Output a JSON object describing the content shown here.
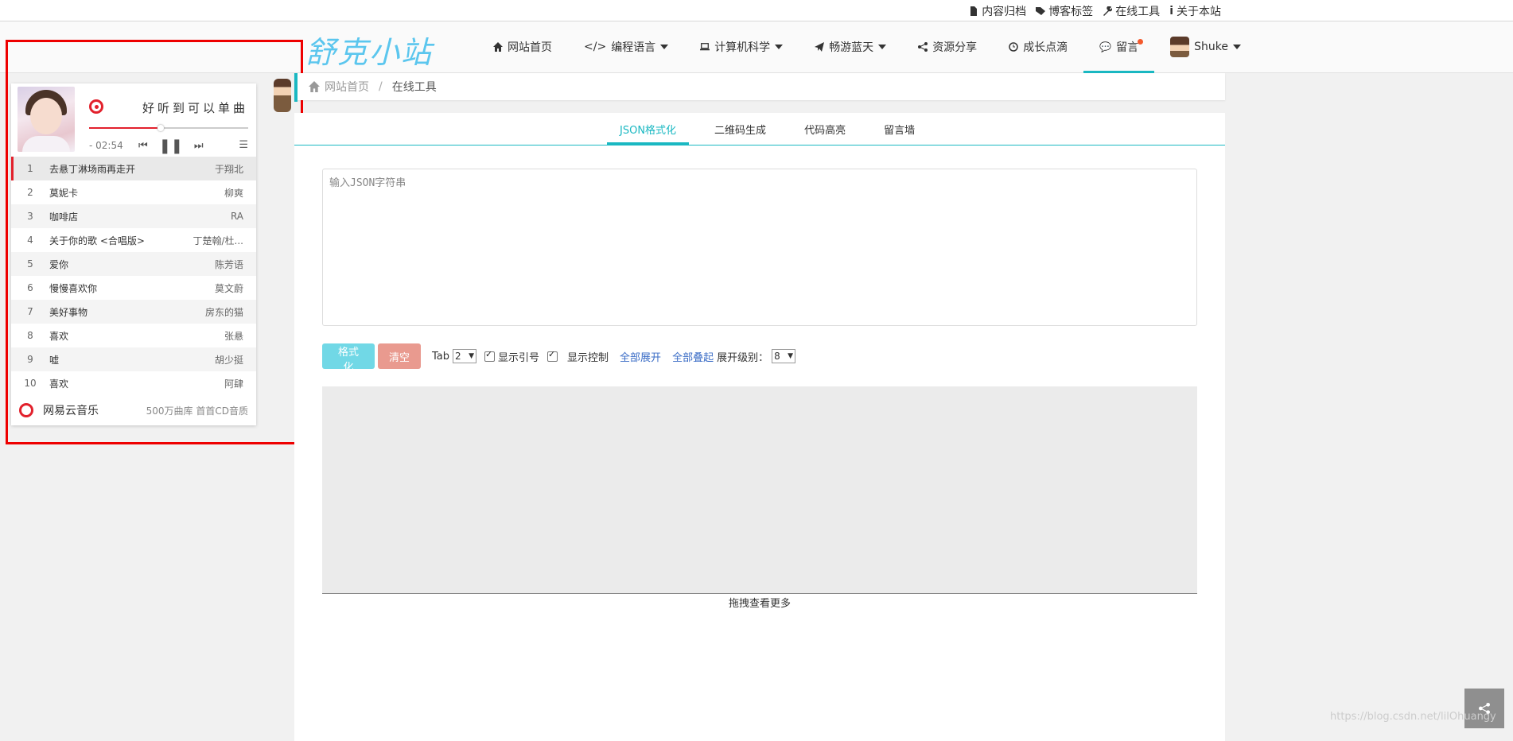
{
  "topbar": {
    "links": [
      {
        "label": "内容归档",
        "icon": "file-icon"
      },
      {
        "label": "博客标签",
        "icon": "tags-icon"
      },
      {
        "label": "在线工具",
        "icon": "wrench-icon"
      },
      {
        "label": "关于本站",
        "icon": "info-icon"
      }
    ]
  },
  "nav": {
    "logo": "舒克小站",
    "items": [
      {
        "label": "网站首页",
        "icon": "home-icon"
      },
      {
        "label": "编程语言",
        "icon": "code-icon"
      },
      {
        "label": "计算机科学",
        "icon": "laptop-icon"
      },
      {
        "label": "畅游蓝天",
        "icon": "paper-plane-icon"
      },
      {
        "label": "资源分享",
        "icon": "share-icon"
      },
      {
        "label": "成长点滴",
        "icon": "clock-icon"
      },
      {
        "label": "留言",
        "icon": "comment-icon"
      },
      {
        "label": "Shuke",
        "icon": "avatar"
      }
    ],
    "accent": "#1ab8c2"
  },
  "player": {
    "title": "好听到可以单曲",
    "time": "- 02:54",
    "progress": 0.45,
    "tracks": [
      {
        "n": "1",
        "title": "去悬丁淋场雨再走开",
        "artist": "于翔北"
      },
      {
        "n": "2",
        "title": "莫妮卡",
        "artist": "柳爽"
      },
      {
        "n": "3",
        "title": "咖啡店",
        "artist": "RA"
      },
      {
        "n": "4",
        "title": "关于你的歌 <合唱版>",
        "artist": "丁楚翰/杜..."
      },
      {
        "n": "5",
        "title": "爱你",
        "artist": "陈芳语"
      },
      {
        "n": "6",
        "title": "慢慢喜欢你",
        "artist": "莫文蔚"
      },
      {
        "n": "7",
        "title": "美好事物",
        "artist": "房东的猫"
      },
      {
        "n": "8",
        "title": "喜欢",
        "artist": "张悬"
      },
      {
        "n": "9",
        "title": "嘘",
        "artist": "胡少挺"
      },
      {
        "n": "10",
        "title": "喜欢",
        "artist": "阿肆"
      }
    ],
    "footer_brand": "网易云音乐",
    "footer_sub": "500万曲库 首首CD音质"
  },
  "breadcrumb": {
    "home": "网站首页",
    "separator": "/",
    "current": "在线工具"
  },
  "tabs": [
    "JSON格式化",
    "二维码生成",
    "代码高亮",
    "留言墙"
  ],
  "editor": {
    "placeholder": "输入JSON字符串",
    "value": ""
  },
  "toolbar": {
    "format_label": "格式化",
    "clear_label": "清空",
    "tab_label": "Tab",
    "tab_value": "2",
    "show_quotes_label": "显示引号",
    "show_controls_label": "显示控制",
    "expand_all_label": "全部展开",
    "collapse_all_label": "全部叠起",
    "expand_level_label": "展开级别：",
    "expand_level_value": "8"
  },
  "result": {
    "drag_hint": "拖拽查看更多"
  },
  "watermark": "https://blog.csdn.net/lilOhuangy"
}
